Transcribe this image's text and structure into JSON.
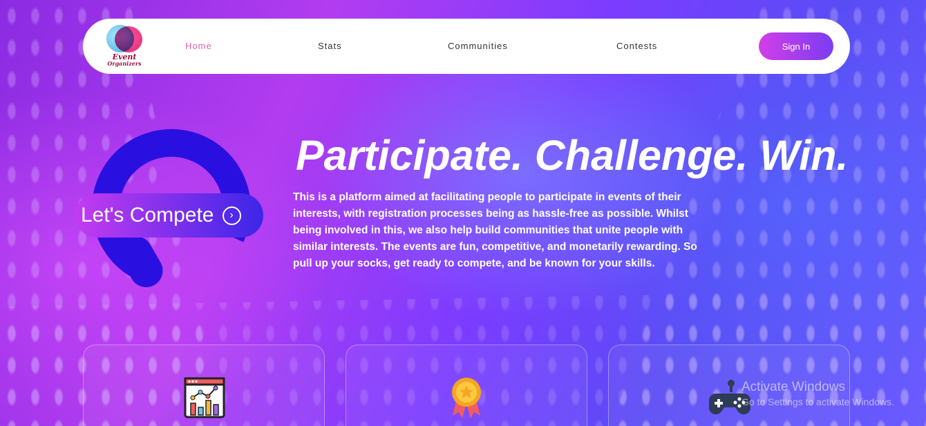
{
  "nav": {
    "logo_line1": "Event",
    "logo_line2": "Organizers",
    "links": [
      {
        "label": "Home",
        "active": true
      },
      {
        "label": "Stats",
        "active": false
      },
      {
        "label": "Communities",
        "active": false
      },
      {
        "label": "Contests",
        "active": false
      }
    ],
    "signin_label": "Sign In"
  },
  "hero": {
    "cta_label": "Let's Compete",
    "title": "Participate. Challenge. Win.",
    "description": "This is a platform aimed at facilitating people to participate in events of their interests, with registration processes being as hassle-free as possible. Whilst being involved in this, we also help build communities that unite people with similar interests. The events are fun, competitive, and monetarily rewarding. So pull up your socks, get ready to compete, and be known for your skills."
  },
  "cards": [
    {
      "icon": "analytics-chart-icon"
    },
    {
      "icon": "medal-icon"
    },
    {
      "icon": "gamepad-icon"
    }
  ],
  "watermark": {
    "line1": "Activate Windows",
    "line2": "Go to Settings to activate Windows."
  },
  "colors": {
    "accent_pink": "#ea5fa9",
    "button_gradient_start": "#d23ee8",
    "button_gradient_end": "#7b3cf2",
    "ring_blue": "#2a10e0"
  }
}
